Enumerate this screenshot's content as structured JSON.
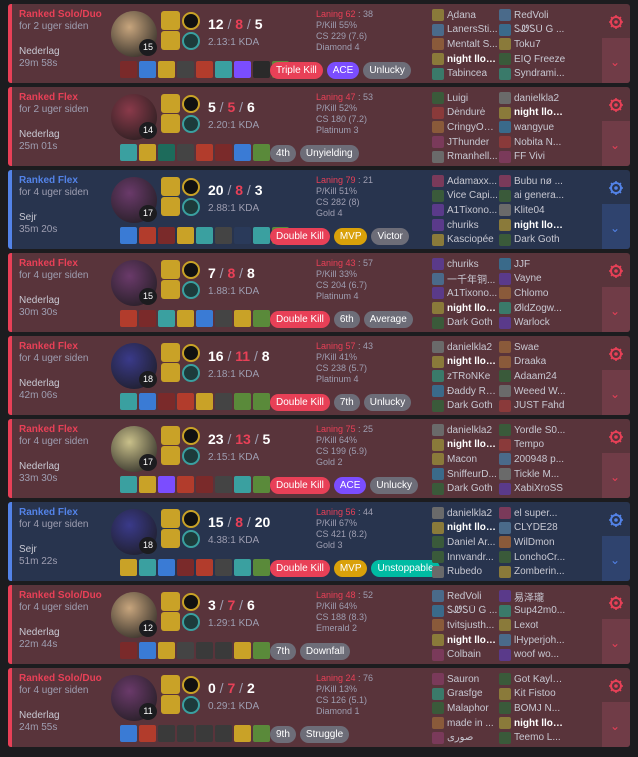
{
  "matches": [
    {
      "outcome": "loss",
      "queue": "Ranked Solo/Duo",
      "ago": "for 2 uger siden",
      "result": "Nederlag",
      "duration": "29m 58s",
      "champion_color": "#c7a57d",
      "level": "15",
      "kills": "12",
      "deaths": "8",
      "assists": "5",
      "kda": "2.13:1 KDA",
      "laning_label": "Laning 62",
      "laning_rest": " : 38",
      "pkill": "P/Kill 55%",
      "cs": "CS 229 (7.6)",
      "rank": "Diamond 4",
      "items": [
        "#7a2a2a",
        "#3a7bd5",
        "#c9a227",
        "#444",
        "#b23c2c",
        "#3aa0a0",
        "#7b4dff",
        "#2a2a2a",
        "#5a8a3a"
      ],
      "badges": [
        {
          "text": "Triple Kill",
          "style": "red"
        },
        {
          "text": "ACE",
          "style": "purple"
        },
        {
          "text": "Unlucky",
          "style": "grey"
        }
      ],
      "team1": [
        "Ądana",
        "LanersSti...",
        "Mentalt S...",
        "night llovel",
        "Tabincea"
      ],
      "team2": [
        "RedVoli",
        "ᏚᏪᏚÜ Ĝ ...",
        "Toku7",
        "EIQ Freeze",
        "Syndrami..."
      ],
      "me_team": 1,
      "me_index": 3
    },
    {
      "outcome": "loss",
      "queue": "Ranked Flex",
      "ago": "for 2 uger siden",
      "result": "Nederlag",
      "duration": "25m 01s",
      "champion_color": "#8a3a4a",
      "level": "14",
      "kills": "5",
      "deaths": "5",
      "assists": "6",
      "kda": "2.20:1 KDA",
      "laning_label": "Laning 47",
      "laning_rest": " : 53",
      "pkill": "P/Kill 52%",
      "cs": "CS 180 (7.2)",
      "rank": "Platinum 3",
      "items": [
        "#3aa0a0",
        "#c9a227",
        "#1d6b5b",
        "#444",
        "#b23c2c",
        "#7a2a2a",
        "#3a7bd5",
        "#5a8a3a"
      ],
      "badges": [
        {
          "text": "4th",
          "style": "grey"
        },
        {
          "text": "Unyielding",
          "style": "grey"
        }
      ],
      "team1": [
        "Luigi",
        "Dėndurė",
        "CringyOni...",
        "JThunder",
        "Rmanhell..."
      ],
      "team2": [
        "danielkla2",
        "night llovel",
        "wangyue",
        "Nobita N...",
        "FF Vivi"
      ],
      "me_team": 2,
      "me_index": 1
    },
    {
      "outcome": "win",
      "queue": "Ranked Flex",
      "ago": "for 4 uger siden",
      "result": "Sejr",
      "duration": "35m 20s",
      "champion_color": "#6a3a6a",
      "level": "17",
      "kills": "20",
      "deaths": "8",
      "assists": "3",
      "kda": "2.88:1 KDA",
      "laning_label": "Laning 79",
      "laning_rest": " : 21",
      "pkill": "P/Kill 51%",
      "cs": "CS 282 (8)",
      "rank": "Gold 4",
      "items": [
        "#3a7bd5",
        "#b23c2c",
        "#7a2a2a",
        "#c9a227",
        "#3aa0a0",
        "#444",
        "#2a3a5a",
        "#3aa0a0",
        "#5a8a3a"
      ],
      "badges": [
        {
          "text": "Double Kill",
          "style": "red"
        },
        {
          "text": "MVP",
          "style": "gold"
        },
        {
          "text": "Victor",
          "style": "grey"
        }
      ],
      "team1": [
        "Adamaxx...",
        "Vice Capi...",
        "A1Tixono...",
        "churiks",
        "Kasciopée"
      ],
      "team2": [
        "Bubu nø ...",
        "ai genera...",
        "Klite04",
        "night llovel",
        "Dark Goth"
      ],
      "me_team": 2,
      "me_index": 3
    },
    {
      "outcome": "loss",
      "queue": "Ranked Flex",
      "ago": "for 4 uger siden",
      "result": "Nederlag",
      "duration": "30m 30s",
      "champion_color": "#6a3a6a",
      "level": "15",
      "kills": "7",
      "deaths": "8",
      "assists": "8",
      "kda": "1.88:1 KDA",
      "laning_label": "Laning 43",
      "laning_rest": " : 57",
      "pkill": "P/Kill 33%",
      "cs": "CS 204 (6.7)",
      "rank": "Platinum 4",
      "items": [
        "#b23c2c",
        "#7a2a2a",
        "#3aa0a0",
        "#c9a227",
        "#3a7bd5",
        "#444",
        "#c9a227",
        "#5a8a3a"
      ],
      "badges": [
        {
          "text": "Double Kill",
          "style": "red"
        },
        {
          "text": "6th",
          "style": "grey"
        },
        {
          "text": "Average",
          "style": "grey"
        }
      ],
      "team1": [
        "churiks",
        "一千年铜...",
        "A1Tixono...",
        "night llovel",
        "Dark Goth"
      ],
      "team2": [
        "JJF",
        "Vayne",
        "Chlomo",
        "ØldZogw...",
        "Warlock"
      ],
      "me_team": 1,
      "me_index": 3
    },
    {
      "outcome": "loss",
      "queue": "Ranked Flex",
      "ago": "for 4 uger siden",
      "result": "Nederlag",
      "duration": "42m 06s",
      "champion_color": "#3a3a8a",
      "level": "18",
      "kills": "16",
      "deaths": "11",
      "assists": "8",
      "kda": "2.18:1 KDA",
      "laning_label": "Laning 57",
      "laning_rest": " : 43",
      "pkill": "P/Kill 41%",
      "cs": "CS 238 (5.7)",
      "rank": "Platinum 4",
      "items": [
        "#3aa0a0",
        "#3a7bd5",
        "#7a2a2a",
        "#b23c2c",
        "#c9a227",
        "#444",
        "#5a8a3a",
        "#5a8a3a"
      ],
      "badges": [
        {
          "text": "Double Kill",
          "style": "red"
        },
        {
          "text": "7th",
          "style": "grey"
        },
        {
          "text": "Unlucky",
          "style": "grey"
        }
      ],
      "team1": [
        "danielkla2",
        "night llovel",
        "zTRoNKe",
        "Ðaddy Rh...",
        "Dark Goth"
      ],
      "team2": [
        "Swae",
        "Draaka",
        "Adaam24",
        "Weeed W...",
        "JUST Fahd"
      ],
      "me_team": 1,
      "me_index": 1
    },
    {
      "outcome": "loss",
      "queue": "Ranked Flex",
      "ago": "for 4 uger siden",
      "result": "Nederlag",
      "duration": "33m 30s",
      "champion_color": "#c9c08a",
      "level": "17",
      "kills": "23",
      "deaths": "13",
      "assists": "5",
      "kda": "2.15:1 KDA",
      "laning_label": "Laning 75",
      "laning_rest": " : 25",
      "pkill": "P/Kill 64%",
      "cs": "CS 199 (5.9)",
      "rank": "Gold 2",
      "items": [
        "#3aa0a0",
        "#c9a227",
        "#7b4dff",
        "#b23c2c",
        "#7a2a2a",
        "#444",
        "#3aa0a0",
        "#5a8a3a"
      ],
      "badges": [
        {
          "text": "Double Kill",
          "style": "red"
        },
        {
          "text": "ACE",
          "style": "purple"
        },
        {
          "text": "Unlucky",
          "style": "grey"
        }
      ],
      "team1": [
        "danielkla2",
        "night llovel",
        "Macon",
        "SniffeurD...",
        "Dark Goth"
      ],
      "team2": [
        "Yordle S0...",
        "Tempo",
        "200948 p...",
        "Tickle M...",
        "XabiXroSS"
      ],
      "me_team": 1,
      "me_index": 1
    },
    {
      "outcome": "win",
      "queue": "Ranked Flex",
      "ago": "for 4 uger siden",
      "result": "Sejr",
      "duration": "51m 22s",
      "champion_color": "#3a3a8a",
      "level": "18",
      "kills": "15",
      "deaths": "8",
      "assists": "20",
      "kda": "4.38:1 KDA",
      "laning_label": "Laning 56",
      "laning_rest": " : 44",
      "pkill": "P/Kill 67%",
      "cs": "CS 421 (8.2)",
      "rank": "Gold 3",
      "items": [
        "#c9a227",
        "#3aa0a0",
        "#3a7bd5",
        "#7a2a2a",
        "#b23c2c",
        "#444",
        "#3aa0a0",
        "#5a8a3a"
      ],
      "badges": [
        {
          "text": "Double Kill",
          "style": "red"
        },
        {
          "text": "MVP",
          "style": "gold"
        },
        {
          "text": "Unstoppable",
          "style": "green"
        }
      ],
      "team1": [
        "danielkla2",
        "night llovel",
        "Daniel Ar...",
        "Innvandr...",
        "Rubedo"
      ],
      "team2": [
        "el super...",
        "CLYDE28",
        "WilDmon",
        "LonchoCr...",
        "Zomberin..."
      ],
      "me_team": 1,
      "me_index": 1
    },
    {
      "outcome": "loss",
      "queue": "Ranked Solo/Duo",
      "ago": "for 4 uger siden",
      "result": "Nederlag",
      "duration": "22m 44s",
      "champion_color": "#c7a57d",
      "level": "12",
      "kills": "3",
      "deaths": "7",
      "assists": "6",
      "kda": "1.29:1 KDA",
      "laning_label": "Laning 48",
      "laning_rest": " : 52",
      "pkill": "P/Kill 64%",
      "cs": "CS 188 (8.3)",
      "rank": "Emerald 2",
      "items": [
        "#7a2a2a",
        "#3a7bd5",
        "#c9a227",
        "#444",
        "#3a3a3a",
        "#3a3a3a",
        "#c9a227",
        "#5a8a3a"
      ],
      "badges": [
        {
          "text": "7th",
          "style": "grey"
        },
        {
          "text": "Downfall",
          "style": "grey"
        }
      ],
      "team1": [
        "RedVoli",
        "ᏚᏪᏚÜ Ĝ ...",
        "tvitsjusth...",
        "night llovel",
        "Colbain"
      ],
      "team2": [
        "易泽瓏",
        "Sup42m0...",
        "Lexot",
        "lHyperjoh...",
        "woof wo..."
      ],
      "me_team": 1,
      "me_index": 3
    },
    {
      "outcome": "loss",
      "queue": "Ranked Solo/Duo",
      "ago": "for 4 uger siden",
      "result": "Nederlag",
      "duration": "24m 55s",
      "champion_color": "#6a3a6a",
      "level": "11",
      "kills": "0",
      "deaths": "7",
      "assists": "2",
      "kda": "0.29:1 KDA",
      "laning_label": "Laning 24",
      "laning_rest": " : 76",
      "pkill": "P/Kill 13%",
      "cs": "CS 126 (5.1)",
      "rank": "Diamond 1",
      "items": [
        "#3a7bd5",
        "#b23c2c",
        "#3a3a3a",
        "#3a3a3a",
        "#3a3a3a",
        "#3a3a3a",
        "#c9a227",
        "#5a8a3a"
      ],
      "badges": [
        {
          "text": "9th",
          "style": "grey"
        },
        {
          "text": "Struggle",
          "style": "grey"
        }
      ],
      "team1": [
        "Sauron",
        "Grasfge",
        "Malaphor",
        "made in ...",
        "صوری"
      ],
      "team2": [
        "Got Kayle...",
        "Kit Fistoo",
        "BOMJ N...",
        "night llovel",
        "Teemo L..."
      ],
      "me_team": 2,
      "me_index": 3
    }
  ],
  "colors": {
    "loss_bg": "#59343b",
    "win_bg": "#28344e",
    "loss_accent": "#e84057",
    "win_accent": "#5383e8",
    "mvp_gold": "#d9a10a"
  },
  "icons": {
    "expand": "chevron-down-icon",
    "summoner": "summoner-spell-icon",
    "rune": "rune-icon",
    "settings": "gear-icon"
  },
  "ui": {
    "chevron": "⌄"
  }
}
